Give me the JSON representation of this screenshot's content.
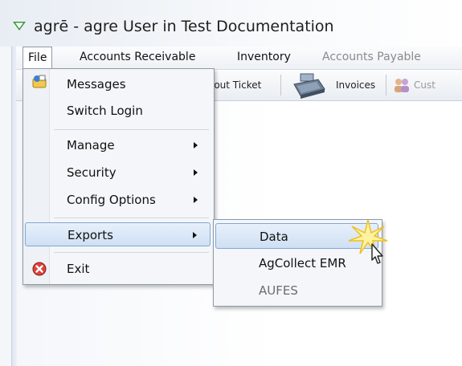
{
  "window": {
    "title": "agrē - agre User in Test Documentation",
    "logo_icon": "green-v-logo-icon"
  },
  "menubar": {
    "items": [
      {
        "label": "File"
      },
      {
        "label": "Accounts Receivable"
      },
      {
        "label": "Inventory"
      },
      {
        "label": "Accounts Payable"
      }
    ]
  },
  "toolbar": {
    "ticket_label": "lout Ticket",
    "invoices_label": "Invoices",
    "customers_label": "Cust"
  },
  "file_menu": {
    "items": [
      {
        "label": "Messages",
        "icon": "messages-icon",
        "has_submenu": false
      },
      {
        "label": "Switch Login",
        "has_submenu": false
      },
      {
        "label": "Manage",
        "has_submenu": true
      },
      {
        "label": "Security",
        "has_submenu": true
      },
      {
        "label": "Config Options",
        "has_submenu": true
      },
      {
        "label": "Exports",
        "has_submenu": true,
        "highlighted": true
      },
      {
        "label": "Exit",
        "icon": "exit-icon",
        "has_submenu": false
      }
    ]
  },
  "exports_submenu": {
    "items": [
      {
        "label": "Data",
        "highlighted": true
      },
      {
        "label": "AgCollect EMR"
      },
      {
        "label": "AUFES",
        "disabled": true
      }
    ]
  },
  "colors": {
    "highlight_border": "#84a6d0",
    "highlight_fill": "#cfe0f4",
    "menu_bg": "#f4f6f9"
  }
}
